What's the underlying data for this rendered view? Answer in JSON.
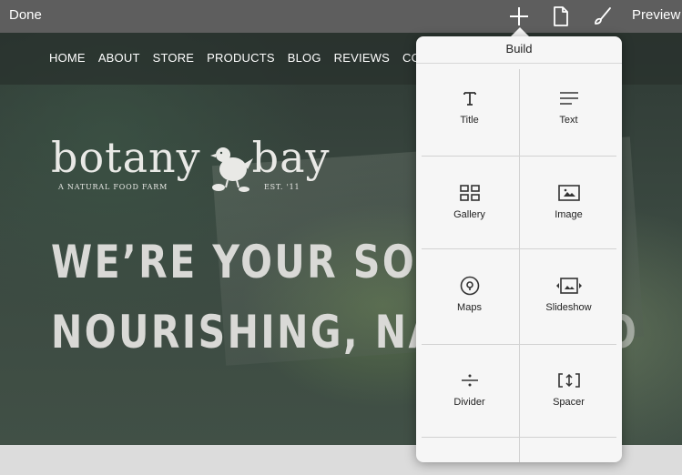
{
  "toolbar": {
    "done_label": "Done",
    "preview_label": "Preview",
    "icons": [
      "plus-icon",
      "page-icon",
      "brush-icon"
    ]
  },
  "nav": {
    "items": [
      "HOME",
      "ABOUT",
      "STORE",
      "PRODUCTS",
      "BLOG",
      "REVIEWS",
      "CONTACT"
    ]
  },
  "logo": {
    "word_left": "botany",
    "word_right": "bay",
    "tagline": "A NATURAL FOOD FARM",
    "est": "EST. '11"
  },
  "hero": {
    "headline_line1": "WE’RE YOUR SOUR",
    "headline_line2": "NOURISHING, NATU",
    "headline_line2_tail": "O"
  },
  "build_popover": {
    "title": "Build",
    "blocks": [
      {
        "label": "Title",
        "icon": "title-icon"
      },
      {
        "label": "Text",
        "icon": "text-icon"
      },
      {
        "label": "Gallery",
        "icon": "gallery-icon"
      },
      {
        "label": "Image",
        "icon": "image-icon"
      },
      {
        "label": "Maps",
        "icon": "map-pin-icon"
      },
      {
        "label": "Slideshow",
        "icon": "slideshow-icon"
      },
      {
        "label": "Divider",
        "icon": "divider-icon"
      },
      {
        "label": "Spacer",
        "icon": "spacer-icon"
      }
    ]
  },
  "colors": {
    "toolbar_bg": "#5e5e5e",
    "popover_bg": "#f6f6f6",
    "headline": "#d9d9d6"
  }
}
